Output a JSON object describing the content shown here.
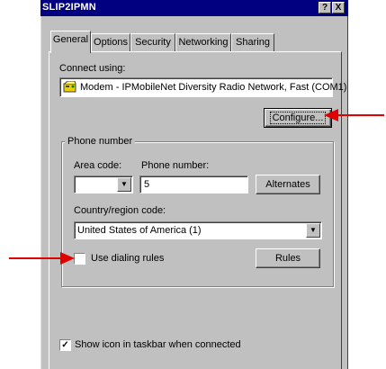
{
  "window": {
    "title": "SLIP2IPMN",
    "help_button": "?",
    "close_button": "X"
  },
  "tabs": [
    {
      "label": "General",
      "active": true
    },
    {
      "label": "Options",
      "active": false
    },
    {
      "label": "Security",
      "active": false
    },
    {
      "label": "Networking",
      "active": false
    },
    {
      "label": "Sharing",
      "active": false
    }
  ],
  "connect": {
    "label": "Connect using:",
    "device": "Modem - IPMobileNet Diversity Radio Network, Fast (COM1)",
    "device_icon": "modem-icon",
    "configure_button": "Configure..."
  },
  "phone": {
    "group_label": "Phone number",
    "area_code_label": "Area code:",
    "area_code_value": "",
    "phone_number_label": "Phone number:",
    "phone_number_value": "5",
    "alternates_button": "Alternates",
    "country_label": "Country/region code:",
    "country_value": "United States of America (1)",
    "dialing_rules_label": "Use dialing rules",
    "dialing_rules_checked": false,
    "rules_button": "Rules"
  },
  "footer": {
    "show_icon_label": "Show icon in taskbar when connected",
    "show_icon_checked": true
  },
  "colors": {
    "title_bar": "#000080",
    "dialog_face": "#c0c0c0",
    "annotation_arrow": "#e00000"
  }
}
